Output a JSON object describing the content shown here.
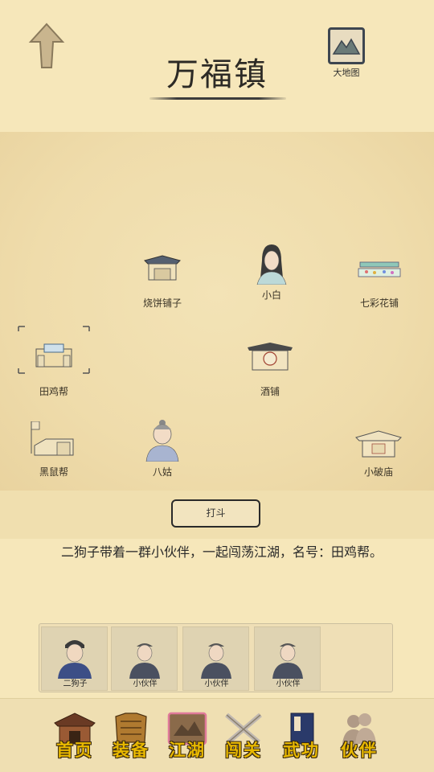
{
  "header": {
    "title": "万福镇",
    "map_label": "大地图"
  },
  "places": [
    {
      "id": "shaobing",
      "label": "烧饼铺子",
      "icon": "shop-icon"
    },
    {
      "id": "xiaobai",
      "label": "小白",
      "icon": "woman-portrait-icon"
    },
    {
      "id": "qicai",
      "label": "七彩花铺",
      "icon": "flower-stall-icon"
    },
    {
      "id": "tianji",
      "label": "田鸡帮",
      "icon": "gang-gate-icon"
    },
    {
      "id": "jiupu",
      "label": "酒铺",
      "icon": "wine-shop-icon"
    },
    {
      "id": "heishu",
      "label": "黑鼠帮",
      "icon": "gang-house-icon"
    },
    {
      "id": "bagu",
      "label": "八姑",
      "icon": "old-woman-portrait-icon"
    },
    {
      "id": "xiaopomiao",
      "label": "小破庙",
      "icon": "temple-icon"
    }
  ],
  "fight_label": "打斗",
  "story_text": "二狗子带着一群小伙伴，一起闯荡江湖，名号：田鸡帮。",
  "team": [
    {
      "name": "二狗子"
    },
    {
      "name": "小伙伴"
    },
    {
      "name": "小伙伴"
    },
    {
      "name": "小伙伴"
    }
  ],
  "nav": [
    {
      "label": "首页",
      "icon": "home-icon"
    },
    {
      "label": "装备",
      "icon": "armor-icon"
    },
    {
      "label": "江湖",
      "icon": "scroll-map-icon",
      "active": true
    },
    {
      "label": "闯关",
      "icon": "crossed-swords-icon"
    },
    {
      "label": "武功",
      "icon": "book-icon"
    },
    {
      "label": "伙伴",
      "icon": "partners-icon"
    }
  ]
}
